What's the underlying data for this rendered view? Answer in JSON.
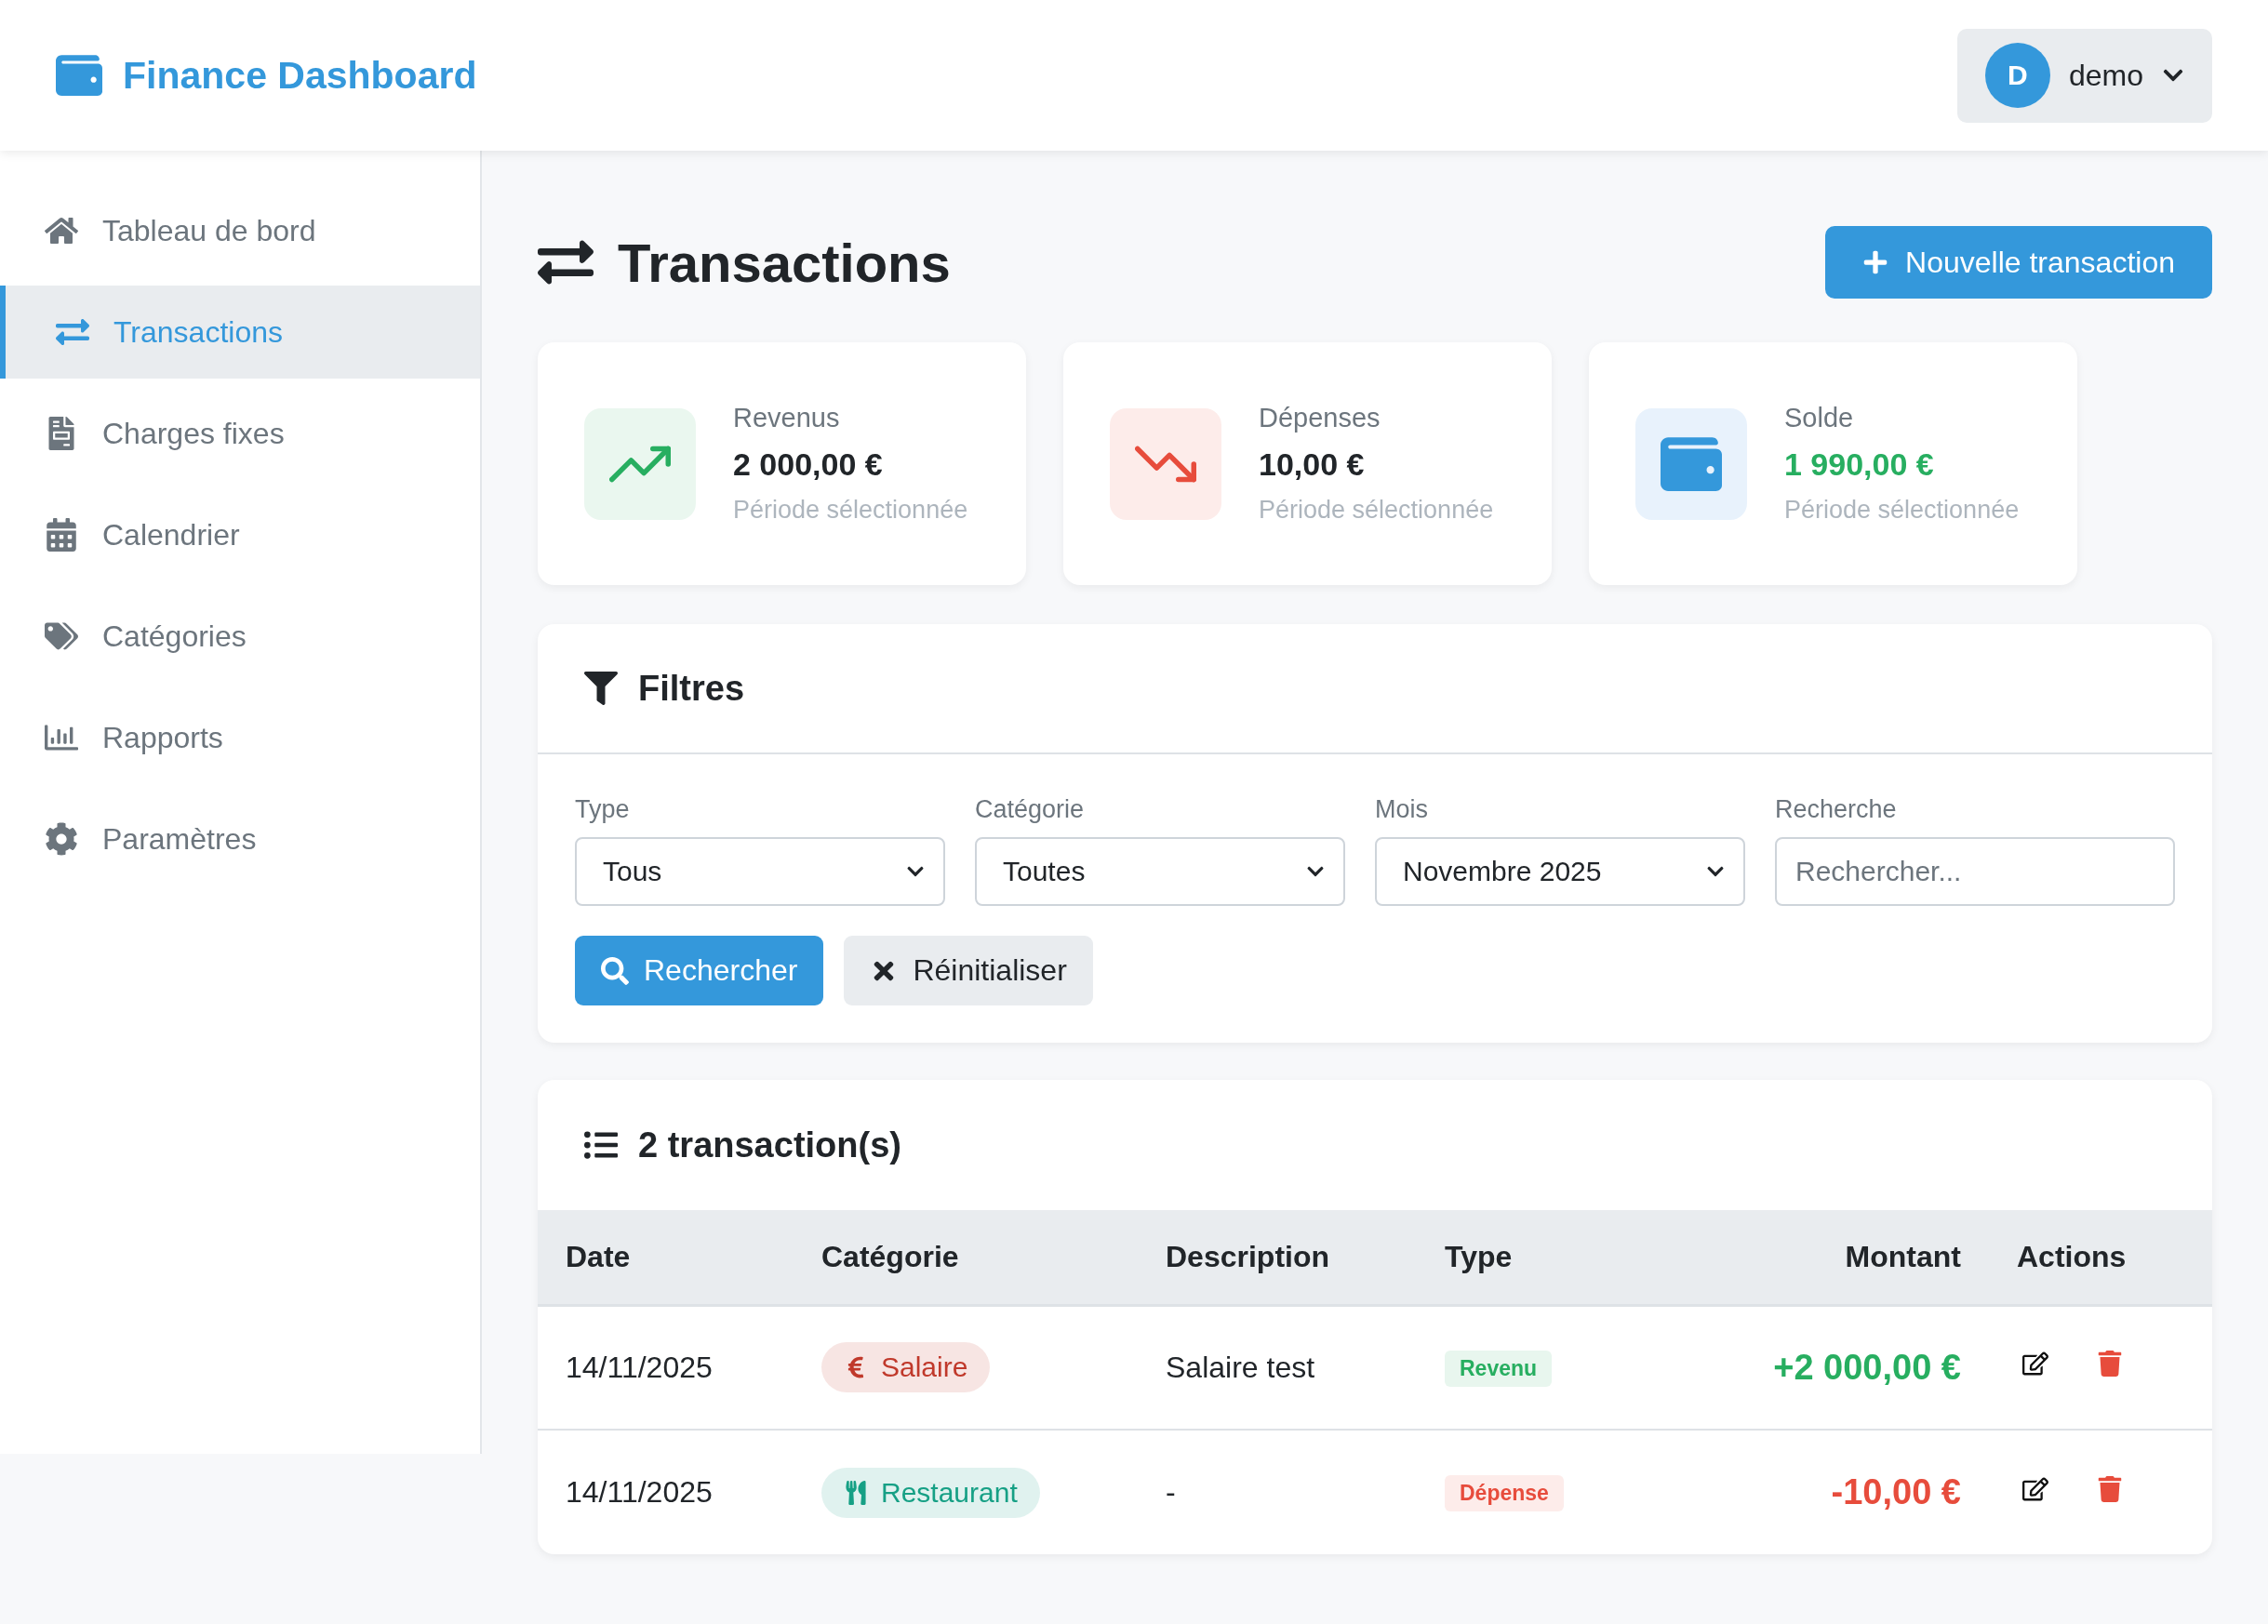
{
  "header": {
    "brand": "Finance Dashboard",
    "user": {
      "initial": "D",
      "name": "demo"
    }
  },
  "sidebar": {
    "items": [
      {
        "label": "Tableau de bord",
        "selected": false
      },
      {
        "label": "Transactions",
        "selected": true
      },
      {
        "label": "Charges fixes",
        "selected": false
      },
      {
        "label": "Calendrier",
        "selected": false
      },
      {
        "label": "Catégories",
        "selected": false
      },
      {
        "label": "Rapports",
        "selected": false
      },
      {
        "label": "Paramètres",
        "selected": false
      }
    ]
  },
  "page": {
    "title": "Transactions",
    "new_button": "Nouvelle transaction"
  },
  "stats": [
    {
      "kind": "income",
      "label": "Revenus",
      "value": "2 000,00 €",
      "note": "Période sélectionnée",
      "positive": false
    },
    {
      "kind": "expense",
      "label": "Dépenses",
      "value": "10,00 €",
      "note": "Période sélectionnée",
      "positive": false
    },
    {
      "kind": "balance",
      "label": "Solde",
      "value": "1 990,00 €",
      "note": "Période sélectionnée",
      "positive": true
    }
  ],
  "filters": {
    "title": "Filtres",
    "fields": [
      {
        "kind": "select",
        "label": "Type",
        "value": "Tous"
      },
      {
        "kind": "select",
        "label": "Catégorie",
        "value": "Toutes"
      },
      {
        "kind": "select",
        "label": "Mois",
        "value": "Novembre 2025"
      },
      {
        "kind": "text",
        "label": "Recherche",
        "placeholder": "Rechercher..."
      }
    ],
    "buttons": [
      {
        "kind": "primary",
        "label": "Rechercher"
      },
      {
        "kind": "secondary",
        "label": "Réinitialiser"
      }
    ]
  },
  "table": {
    "title": "2 transaction(s)",
    "columns": [
      "Date",
      "Catégorie",
      "Description",
      "Type",
      "Montant",
      "Actions"
    ],
    "rows": [
      {
        "kind": "income",
        "date": "14/11/2025",
        "category": {
          "label": "Salaire",
          "color": "#c0392b"
        },
        "description": "Salaire test",
        "type": "Revenu",
        "amount": "+2 000,00 €"
      },
      {
        "kind": "expense",
        "date": "14/11/2025",
        "category": {
          "label": "Restaurant",
          "color": "#16a085"
        },
        "description": "-",
        "type": "Dépense",
        "amount": "-10,00 €"
      }
    ]
  }
}
